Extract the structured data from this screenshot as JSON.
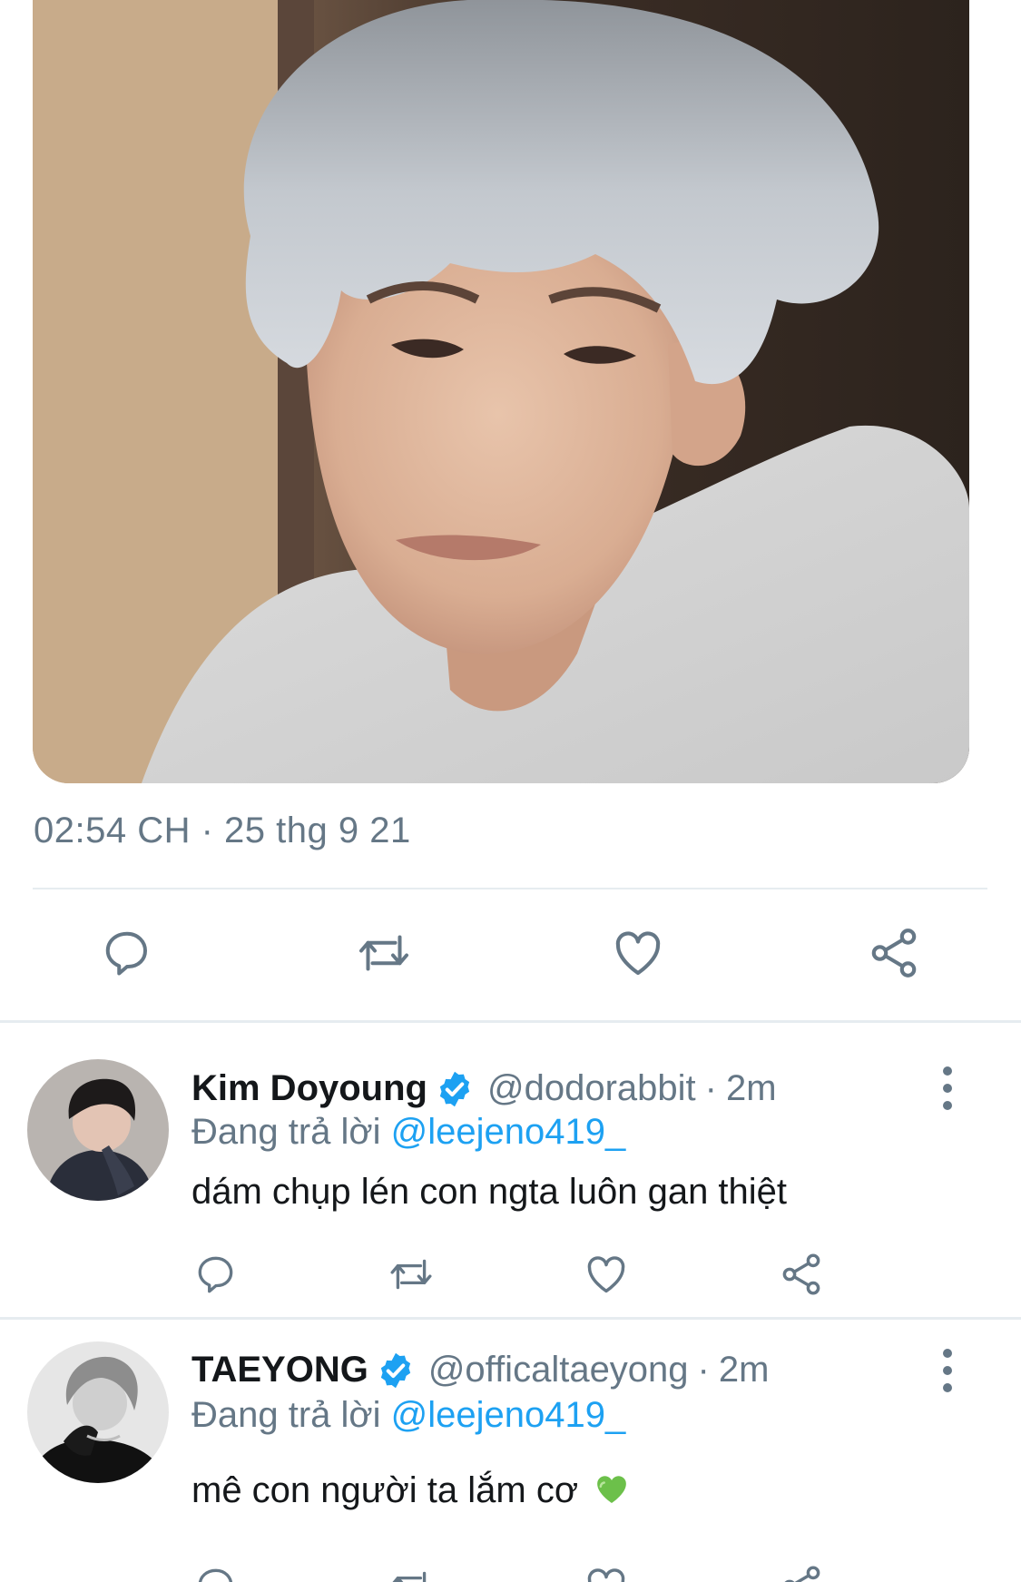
{
  "tweet": {
    "timestamp": "02:54 CH · 25 thg 9 21"
  },
  "icons": {
    "reply": "reply-icon",
    "retweet": "retweet-icon",
    "like": "heart-icon",
    "share": "share-icon",
    "verified": "verified-badge-icon",
    "more": "more-vertical-icon"
  },
  "colors": {
    "accent": "#1da1f2",
    "secondary_text": "#657786",
    "primary_text": "#14171a",
    "divider": "#e6ecf0",
    "verified": "#1da1f2"
  },
  "replies": [
    {
      "display_name": "Kim Doyoung",
      "handle": "@dodorabbit",
      "separator": "·",
      "time": "2m",
      "replying_prefix": "Đang trả lời",
      "replying_to": "@leejeno419_",
      "text": "dám chụp lén con ngta luôn gan thiệt"
    },
    {
      "display_name": "TAEYONG",
      "handle": "@officaltaeyong",
      "separator": "·",
      "time": "2m",
      "replying_prefix": "Đang trả lời",
      "replying_to": "@leejeno419_",
      "text": "mê con người ta lắm cơ",
      "emoji": "green-heart"
    }
  ]
}
